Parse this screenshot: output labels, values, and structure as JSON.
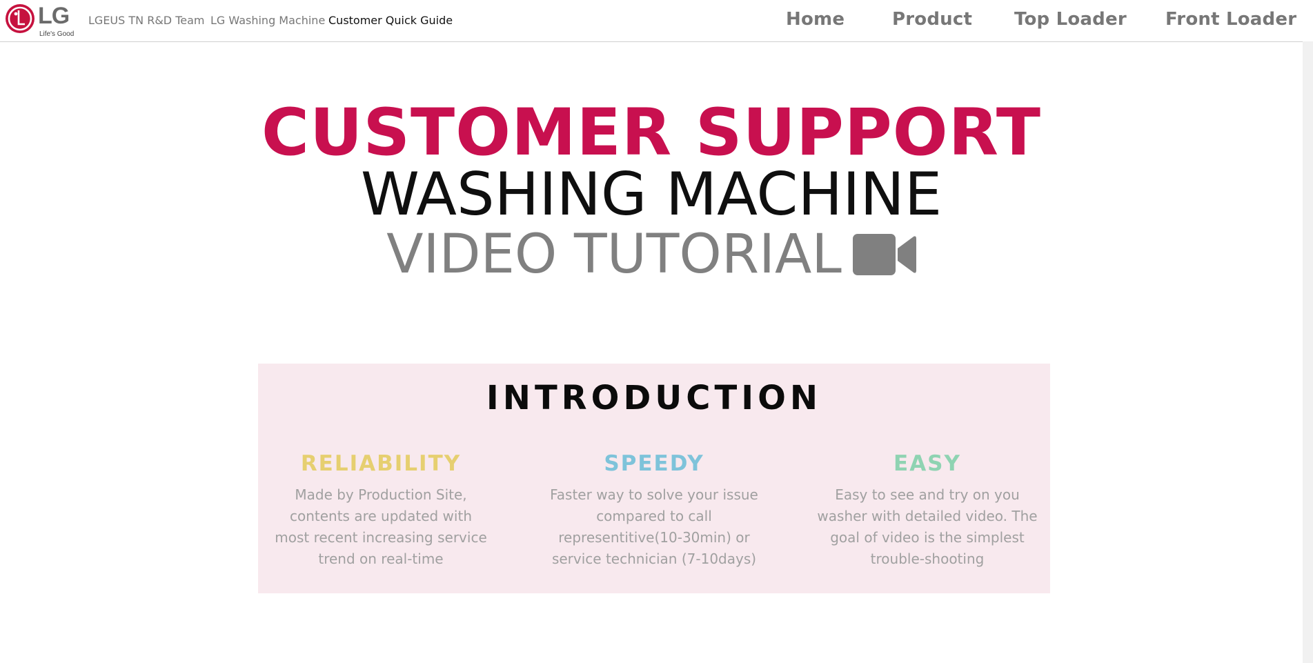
{
  "header": {
    "logo": {
      "brand": "LG",
      "tagline": "Life's Good",
      "brand_color": "#c6123f"
    },
    "breadcrumbs": [
      {
        "label": "LGEUS TN R&D Team"
      },
      {
        "label": "LG Washing Machine"
      },
      {
        "label": "Customer Quick Guide"
      }
    ],
    "nav": [
      {
        "label": "Home"
      },
      {
        "label": "Product"
      },
      {
        "label": "Top Loader"
      },
      {
        "label": "Front Loader"
      }
    ]
  },
  "hero": {
    "line1": "CUSTOMER SUPPORT",
    "line2": "WASHING MACHINE",
    "line3": "VIDEO TUTORIAL",
    "line1_color": "#c8104f",
    "line3_icon": "video-camera-icon"
  },
  "intro": {
    "title": "INTRODUCTION",
    "background": "#f8e9ee",
    "features": [
      {
        "heading": "RELIABILITY",
        "color": "#e6cf70",
        "text": "Made by Production Site, contents are updated with most recent increasing service trend on real-time"
      },
      {
        "heading": "SPEEDY",
        "color": "#7ec3da",
        "text": "Faster way to solve your issue compared to call representitive(10-30min) or service technician (7-10days)"
      },
      {
        "heading": "EASY",
        "color": "#8fd3b2",
        "text": "Easy to see and try on you washer with detailed video. The goal of video is the simplest trouble-shooting"
      }
    ]
  }
}
